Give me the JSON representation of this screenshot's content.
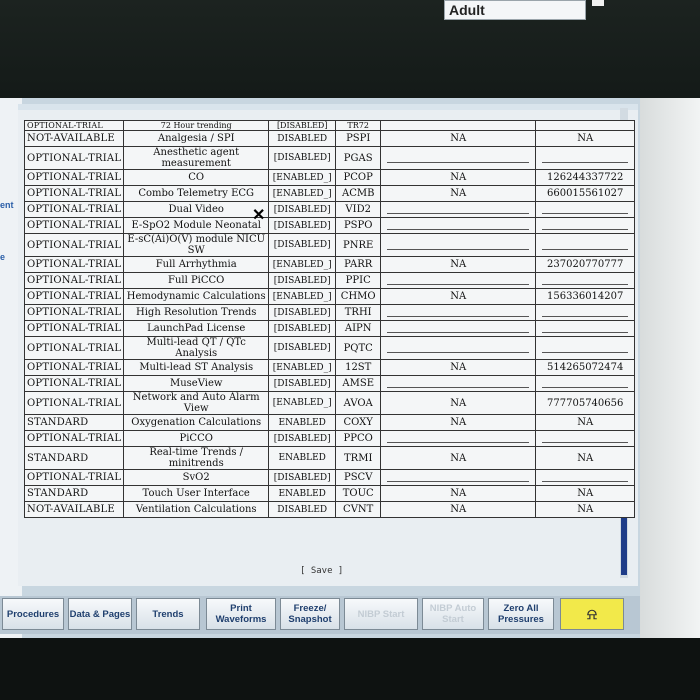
{
  "patient_type": "Adult",
  "left_labels": [
    "ent",
    "e"
  ],
  "top_partial_row": {
    "status": "OPTIONAL-TRIAL",
    "feature": "72 Hour trending",
    "state": "[DISABLED]",
    "code": "TR72"
  },
  "rows": [
    {
      "status": "NOT-AVAILABLE",
      "feature": "Analgesia / SPI",
      "state": "DISABLED",
      "code": "PSPI",
      "c5": "NA",
      "c6": "NA"
    },
    {
      "status": "OPTIONAL-TRIAL",
      "feature": "Anesthetic agent measurement",
      "state": "[DISABLED]",
      "code": "PGAS",
      "c5": "",
      "c6": ""
    },
    {
      "status": "OPTIONAL-TRIAL",
      "feature": "CO",
      "state": "[ENABLED_]",
      "code": "PCOP",
      "c5": "NA",
      "c6": "126244337722"
    },
    {
      "status": "OPTIONAL-TRIAL",
      "feature": "Combo Telemetry ECG",
      "state": "[ENABLED_]",
      "code": "ACMB",
      "c5": "NA",
      "c6": "660015561027"
    },
    {
      "status": "OPTIONAL-TRIAL",
      "feature": "Dual Video",
      "state": "[DISABLED]",
      "code": "VID2",
      "c5": "",
      "c6": ""
    },
    {
      "status": "OPTIONAL-TRIAL",
      "feature": "E-SpO2 Module Neonatal",
      "state": "[DISABLED]",
      "code": "PSPO",
      "c5": "",
      "c6": ""
    },
    {
      "status": "OPTIONAL-TRIAL",
      "feature": "E-sC(Ai)O(V) module NICU SW",
      "state": "[DISABLED]",
      "code": "PNRE",
      "c5": "",
      "c6": ""
    },
    {
      "status": "OPTIONAL-TRIAL",
      "feature": "Full Arrhythmia",
      "state": "[ENABLED_]",
      "code": "PARR",
      "c5": "NA",
      "c6": "237020770777"
    },
    {
      "status": "OPTIONAL-TRIAL",
      "feature": "Full PiCCO",
      "state": "[DISABLED]",
      "code": "PPIC",
      "c5": "",
      "c6": ""
    },
    {
      "status": "OPTIONAL-TRIAL",
      "feature": "Hemodynamic Calculations",
      "state": "[ENABLED_]",
      "code": "CHMO",
      "c5": "NA",
      "c6": "156336014207"
    },
    {
      "status": "OPTIONAL-TRIAL",
      "feature": "High Resolution Trends",
      "state": "[DISABLED]",
      "code": "TRHI",
      "c5": "",
      "c6": ""
    },
    {
      "status": "OPTIONAL-TRIAL",
      "feature": "LaunchPad License",
      "state": "[DISABLED]",
      "code": "AIPN",
      "c5": "",
      "c6": ""
    },
    {
      "status": "OPTIONAL-TRIAL",
      "feature": "Multi-lead QT / QTc Analysis",
      "state": "[DISABLED]",
      "code": "PQTC",
      "c5": "",
      "c6": ""
    },
    {
      "status": "OPTIONAL-TRIAL",
      "feature": "Multi-lead ST Analysis",
      "state": "[ENABLED_]",
      "code": "12ST",
      "c5": "NA",
      "c6": "514265072474"
    },
    {
      "status": "OPTIONAL-TRIAL",
      "feature": "MuseView",
      "state": "[DISABLED]",
      "code": "AMSE",
      "c5": "",
      "c6": ""
    },
    {
      "status": "OPTIONAL-TRIAL",
      "feature": "Network and Auto Alarm View",
      "state": "[ENABLED_]",
      "code": "AVOA",
      "c5": "NA",
      "c6": "777705740656"
    },
    {
      "status": "STANDARD",
      "feature": "Oxygenation Calculations",
      "state": "ENABLED",
      "code": "COXY",
      "c5": "NA",
      "c6": "NA"
    },
    {
      "status": "OPTIONAL-TRIAL",
      "feature": "PiCCO",
      "state": "[DISABLED]",
      "code": "PPCO",
      "c5": "",
      "c6": ""
    },
    {
      "status": "STANDARD",
      "feature": "Real-time Trends / minitrends",
      "state": "ENABLED",
      "code": "TRMI",
      "c5": "NA",
      "c6": "NA"
    },
    {
      "status": "OPTIONAL-TRIAL",
      "feature": "SvO2",
      "state": "[DISABLED]",
      "code": "PSCV",
      "c5": "",
      "c6": ""
    },
    {
      "status": "STANDARD",
      "feature": "Touch User Interface",
      "state": "ENABLED",
      "code": "TOUC",
      "c5": "NA",
      "c6": "NA"
    },
    {
      "status": "NOT-AVAILABLE",
      "feature": "Ventilation Calculations",
      "state": "DISABLED",
      "code": "CVNT",
      "c5": "NA",
      "c6": "NA"
    }
  ],
  "save_label": "[ Save ]",
  "buttons": {
    "procedures": "Procedures",
    "data_pages": "Data & Pages",
    "trends": "Trends",
    "print_waveforms": "Print Waveforms",
    "freeze_snapshot": "Freeze/ Snapshot",
    "nibp_start": "NIBP Start",
    "nibp_auto_start": "NIBP Auto Start",
    "zero_all": "Zero All Pressures",
    "alarm": "alarm-bell-icon"
  }
}
